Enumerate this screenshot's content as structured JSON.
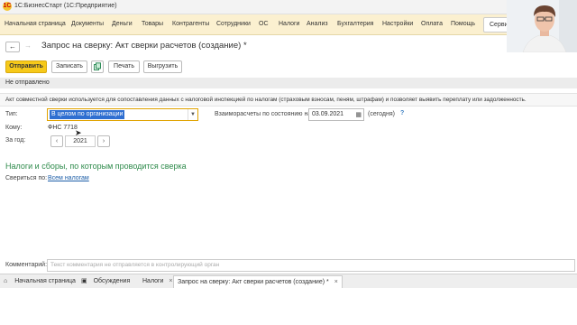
{
  "window": {
    "title": "1С:БизнесСтарт  (1С:Предприятие)",
    "logo": "1С"
  },
  "menu": [
    {
      "label": "Начальная страница"
    },
    {
      "label": "Документы"
    },
    {
      "label": "Деньги"
    },
    {
      "label": "Товары"
    },
    {
      "label": "Контрагенты"
    },
    {
      "label": "Сотрудники"
    },
    {
      "label": "ОС"
    },
    {
      "label": "Налоги"
    },
    {
      "label": "Анализ"
    },
    {
      "label": "Бухгалтерия"
    },
    {
      "label": "Настройки"
    },
    {
      "label": "Оплата"
    },
    {
      "label": "Помощь"
    },
    {
      "label": "Сервис"
    }
  ],
  "page": {
    "title": "Запрос на сверку: Акт сверки расчетов (создание) *",
    "back": "←",
    "forward": "→"
  },
  "toolbar": {
    "send": "Отправить",
    "write": "Записать",
    "print": "Печать",
    "upload": "Выгрузить"
  },
  "status": "Не отправлено",
  "info": "Акт совместной сверки используется для сопоставления данных с налоговой инспекцией по налогам (страховым взносам, пеням, штрафам) и позволяет выявить переплату или задолженность.",
  "form": {
    "type_label": "Тип:",
    "type_value": "В целом по организации",
    "settlements_label": "Взаиморасчеты по состоянию на:",
    "date_value": "03.09.2021",
    "date_note": "(сегодня)",
    "help": "?",
    "to_label": "Кому:",
    "to_value": "ФНС 7718",
    "year_label": "За год:",
    "year_value": "2021",
    "year_prev": "‹",
    "year_next": "›"
  },
  "section": {
    "title": "Налоги и сборы, по которым проводится сверка",
    "reconcile_label": "Свериться по:",
    "reconcile_link": "Всем налогам"
  },
  "comment": {
    "label": "Комментарий:",
    "placeholder": "Текст комментария не отправляется в контролирующий орган"
  },
  "taskbar": [
    {
      "label": "Начальная страница"
    },
    {
      "label": "Обсуждения"
    },
    {
      "label": "Налоги",
      "close": "×"
    },
    {
      "label": "Запрос на сверку: Акт сверки расчетов (создание) *",
      "close": "×"
    }
  ],
  "colors": {
    "accent": "#f6c91a",
    "menubar": "#fbf0d0",
    "section_title": "#2d8a4a",
    "link": "#1e5fa8"
  }
}
